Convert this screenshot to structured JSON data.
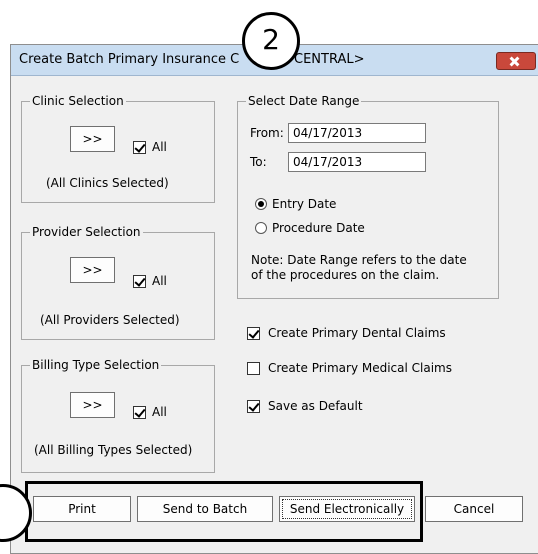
{
  "window": {
    "title": "Create Batch Primary Insurance C",
    "title_suffix": "CENTRAL>"
  },
  "callouts": {
    "number_2": "2"
  },
  "clinic_selection": {
    "title": "Clinic Selection",
    "button_label": ">>",
    "all_label": "All",
    "all_checked": true,
    "status": "(All Clinics Selected)"
  },
  "provider_selection": {
    "title": "Provider Selection",
    "button_label": ">>",
    "all_label": "All",
    "all_checked": true,
    "status": "(All Providers Selected)"
  },
  "billing_type_selection": {
    "title": "Billing Type Selection",
    "button_label": ">>",
    "all_label": "All",
    "all_checked": true,
    "status": "(All Billing Types Selected)"
  },
  "date_range": {
    "title": "Select Date Range",
    "from_label": "From:",
    "from_value": "04/17/2013",
    "to_label": "To:",
    "to_value": "04/17/2013",
    "entry_date_label": "Entry Date",
    "entry_date_selected": true,
    "procedure_date_label": "Procedure Date",
    "procedure_date_selected": false,
    "note_line1": "Note: Date Range refers to the date",
    "note_line2": "of the procedures on the claim."
  },
  "options": {
    "dental_label": "Create Primary Dental Claims",
    "dental_checked": true,
    "medical_label": "Create Primary Medical Claims",
    "medical_checked": false,
    "save_default_label": "Save as Default",
    "save_default_checked": true
  },
  "buttons": {
    "print": "Print",
    "send_to_batch": "Send to Batch",
    "send_electronically": "Send Electronically",
    "cancel": "Cancel"
  },
  "colors": {
    "titlebar": "#c9ddf1",
    "close_button": "#c9483b",
    "dialog_bg": "#f0f0f0"
  }
}
